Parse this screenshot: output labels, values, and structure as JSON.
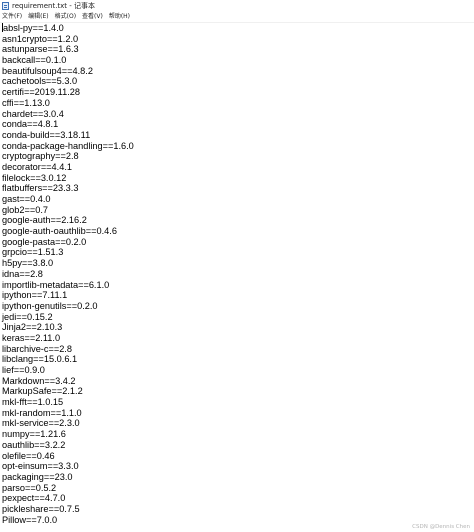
{
  "window": {
    "title": "requirement.txt - 记事本"
  },
  "menu": {
    "items": [
      "文件(F)",
      "编辑(E)",
      "格式(O)",
      "查看(V)",
      "帮助(H)"
    ]
  },
  "editor": {
    "lines": [
      "absl-py==1.4.0",
      "asn1crypto==1.2.0",
      "astunparse==1.6.3",
      "backcall==0.1.0",
      "beautifulsoup4==4.8.2",
      "cachetools==5.3.0",
      "certifi==2019.11.28",
      "cffi==1.13.0",
      "chardet==3.0.4",
      "conda==4.8.1",
      "conda-build==3.18.11",
      "conda-package-handling==1.6.0",
      "cryptography==2.8",
      "decorator==4.4.1",
      "filelock==3.0.12",
      "flatbuffers==23.3.3",
      "gast==0.4.0",
      "glob2==0.7",
      "google-auth==2.16.2",
      "google-auth-oauthlib==0.4.6",
      "google-pasta==0.2.0",
      "grpcio==1.51.3",
      "h5py==3.8.0",
      "idna==2.8",
      "importlib-metadata==6.1.0",
      "ipython==7.11.1",
      "ipython-genutils==0.2.0",
      "jedi==0.15.2",
      "Jinja2==2.10.3",
      "keras==2.11.0",
      "libarchive-c==2.8",
      "libclang==15.0.6.1",
      "lief==0.9.0",
      "Markdown==3.4.2",
      "MarkupSafe==2.1.2",
      "mkl-fft==1.0.15",
      "mkl-random==1.1.0",
      "mkl-service==2.3.0",
      "numpy==1.21.6",
      "oauthlib==3.2.2",
      "olefile==0.46",
      "opt-einsum==3.3.0",
      "packaging==23.0",
      "parso==0.5.2",
      "pexpect==4.7.0",
      "pickleshare==0.7.5",
      "Pillow==7.0.0"
    ]
  },
  "watermark": {
    "text": "CSDN @Dennis Chen"
  }
}
